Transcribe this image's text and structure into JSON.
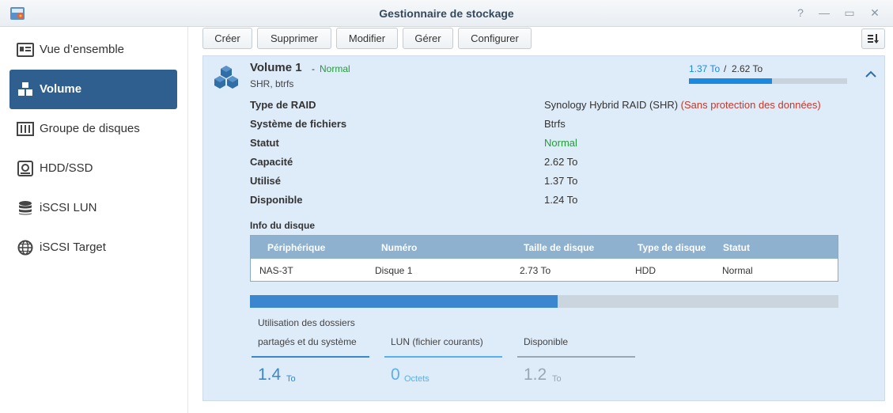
{
  "window": {
    "title": "Gestionnaire de stockage",
    "help": "?",
    "minimize": "—",
    "maximize": "▭",
    "close": "✕"
  },
  "sidebar": {
    "items": [
      {
        "label": "Vue d’ensemble",
        "icon": "overview-icon",
        "active": false
      },
      {
        "label": "Volume",
        "icon": "volume-cubes-icon",
        "active": true
      },
      {
        "label": "Groupe de disques",
        "icon": "disk-group-icon",
        "active": false
      },
      {
        "label": "HDD/SSD",
        "icon": "hdd-icon",
        "active": false
      },
      {
        "label": "iSCSI LUN",
        "icon": "database-icon",
        "active": false
      },
      {
        "label": "iSCSI Target",
        "icon": "globe-icon",
        "active": false
      }
    ]
  },
  "toolbar": {
    "create": "Créer",
    "delete": "Supprimer",
    "modify": "Modifier",
    "manage": "Gérer",
    "configure": "Configurer"
  },
  "volume": {
    "name": "Volume 1",
    "separator": "-",
    "status": "Normal",
    "fs_summary": "SHR, btrfs",
    "used": "1.37 To",
    "slash": "/",
    "total": "2.62 To",
    "used_fraction": 0.523,
    "properties": [
      {
        "label": "Type de RAID",
        "value": "Synology Hybrid RAID (SHR)",
        "extra": "(Sans protection des données)"
      },
      {
        "label": "Système de fichiers",
        "value": "Btrfs"
      },
      {
        "label": "Statut",
        "value": "Normal"
      },
      {
        "label": "Capacité",
        "value": "2.62 To"
      },
      {
        "label": "Utilisé",
        "value": "1.37 To"
      },
      {
        "label": "Disponible",
        "value": "1.24 To"
      }
    ]
  },
  "disk_info": {
    "title": "Info du disque",
    "headers": [
      "Périphérique",
      "Numéro",
      "Taille de disque",
      "Type de disque",
      "Statut"
    ],
    "rows": [
      [
        "NAS-3T",
        "Disque 1",
        "2.73 To",
        "HDD",
        "Normal"
      ]
    ]
  },
  "usage": {
    "used_fraction": 0.523,
    "stats": [
      {
        "label_line1": "Utilisation des dossiers",
        "label_line2": "partagés et du système",
        "value": "1.4",
        "unit": "To",
        "color": "#3a86cf"
      },
      {
        "label_line1": "",
        "label_line2": "LUN (fichier courants)",
        "value": "0",
        "unit": "Octets",
        "color": "#5ab0ec"
      },
      {
        "label_line1": "",
        "label_line2": "Disponible",
        "value": "1.2",
        "unit": "To",
        "color": "#9aa7b3"
      }
    ]
  },
  "colors": {
    "accent": "#2f5f8f",
    "green": "#259b3c",
    "red": "#c0392b",
    "blue": "#1a8ae0"
  }
}
